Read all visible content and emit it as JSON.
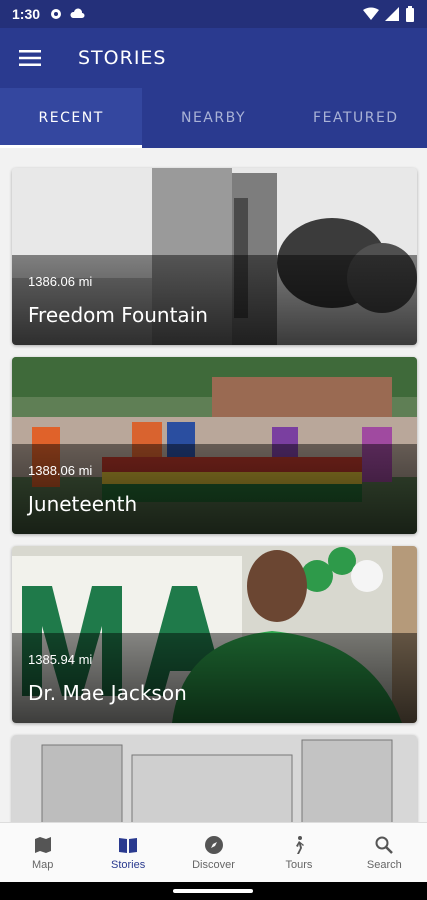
{
  "status_bar": {
    "time": "1:30"
  },
  "app_bar": {
    "title": "STORIES"
  },
  "tabs": [
    {
      "label": "RECENT",
      "active": true
    },
    {
      "label": "NEARBY",
      "active": false
    },
    {
      "label": "FEATURED",
      "active": false
    }
  ],
  "stories": [
    {
      "distance": "1386.06 mi",
      "title": "Freedom Fountain"
    },
    {
      "distance": "1388.06 mi",
      "title": "Juneteenth"
    },
    {
      "distance": "1385.94 mi",
      "title": "Dr. Mae Jackson"
    },
    {
      "distance": "",
      "title": ""
    }
  ],
  "bottom_nav": [
    {
      "label": "Map",
      "icon": "map-icon"
    },
    {
      "label": "Stories",
      "icon": "book-icon",
      "active": true
    },
    {
      "label": "Discover",
      "icon": "compass-icon"
    },
    {
      "label": "Tours",
      "icon": "walk-icon"
    },
    {
      "label": "Search",
      "icon": "search-icon"
    }
  ],
  "colors": {
    "primary": "#2a3a8f",
    "status_bar": "#24307a"
  }
}
